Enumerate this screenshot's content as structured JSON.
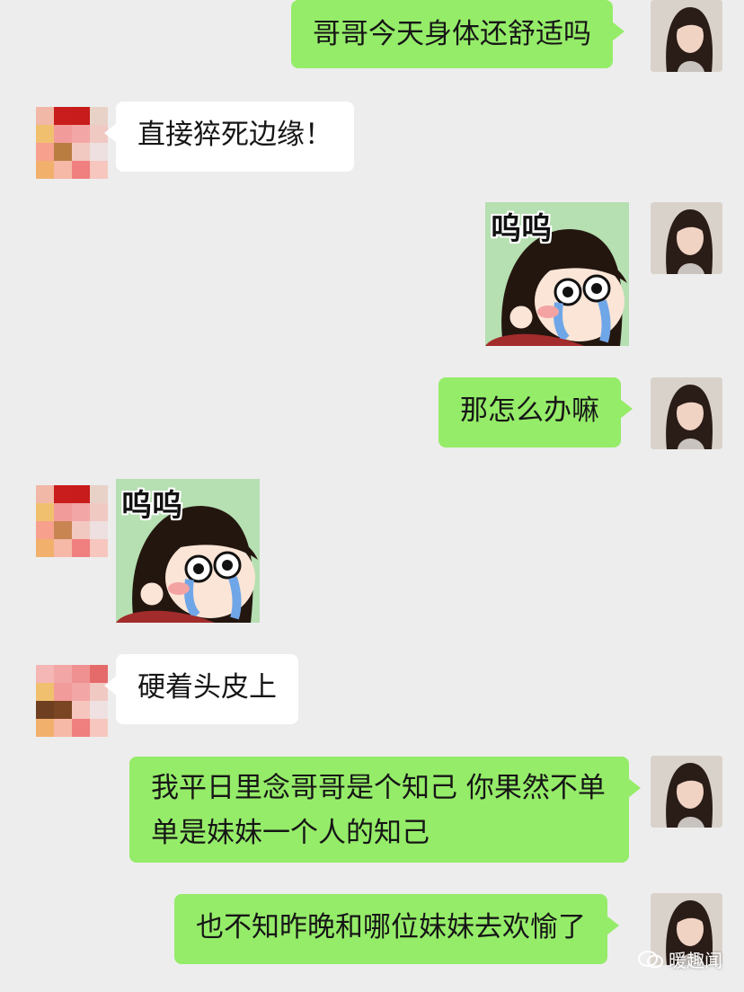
{
  "colors": {
    "background": "#ededed",
    "my_bubble": "#95ec69",
    "other_bubble": "#ffffff"
  },
  "messages": [
    {
      "sender": "me",
      "type": "text",
      "text": "哥哥今天身体还舒适吗"
    },
    {
      "sender": "other",
      "type": "text",
      "text": "直接猝死边缘！"
    },
    {
      "sender": "me",
      "type": "sticker",
      "sticker_text": "呜呜"
    },
    {
      "sender": "me",
      "type": "text",
      "text": "那怎么办嘛"
    },
    {
      "sender": "other",
      "type": "sticker",
      "sticker_text": "呜呜"
    },
    {
      "sender": "other",
      "type": "text",
      "text": "硬着头皮上"
    },
    {
      "sender": "me",
      "type": "text",
      "text": "我平日里念哥哥是个知己 你果然不单单是妹妹一个人的知己"
    },
    {
      "sender": "me",
      "type": "text",
      "text": "也不知昨晚和哪位妹妹去欢愉了"
    }
  ],
  "watermark": {
    "text": "暖趣闻",
    "icon": "wechat-official-account-icon"
  }
}
